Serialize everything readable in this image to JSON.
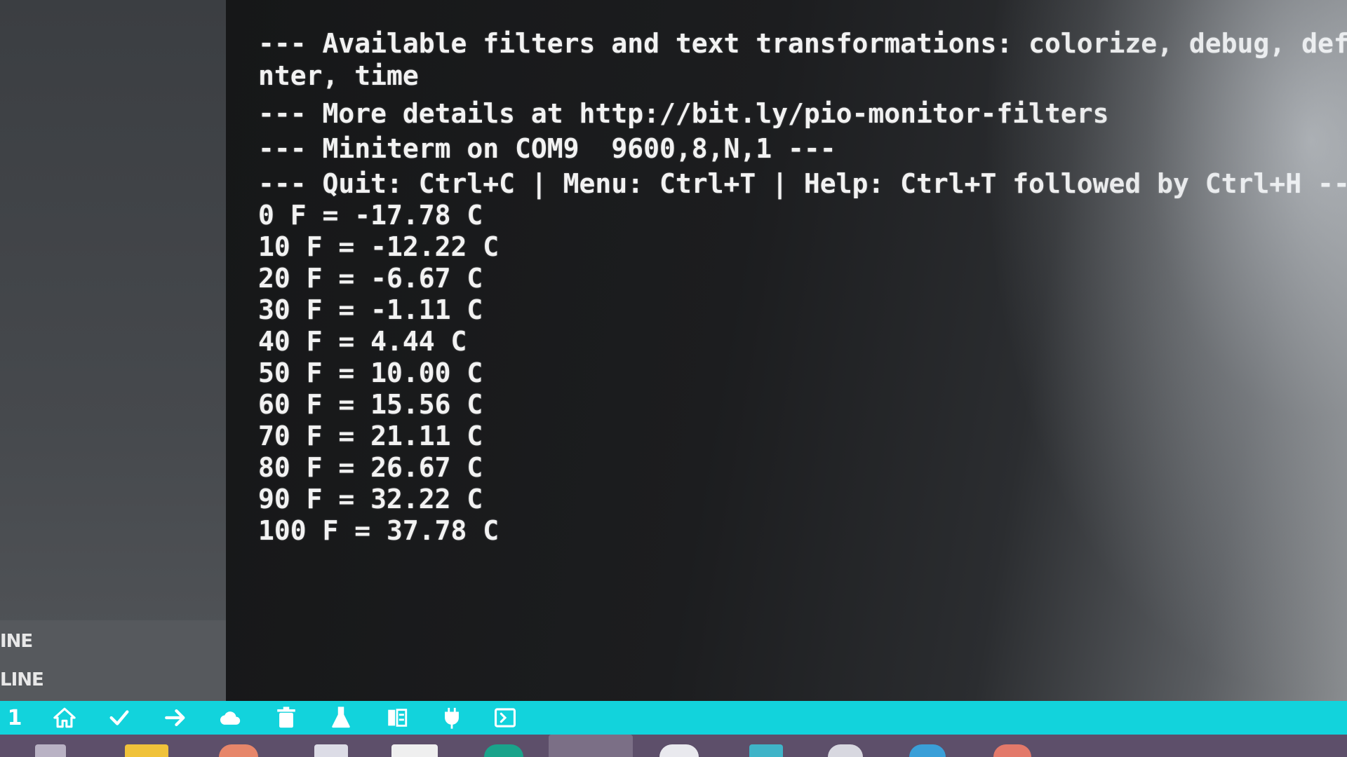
{
  "sidebar": {
    "outline_items": [
      "INE",
      "LINE"
    ]
  },
  "terminal": {
    "lines": [
      "--- Available filters and text transformations: colorize, debug, defa",
      "nter, time",
      "--- More details at http://bit.ly/pio-monitor-filters",
      "--- Miniterm on COM9  9600,8,N,1 ---",
      "--- Quit: Ctrl+C | Menu: Ctrl+T | Help: Ctrl+T followed by Ctrl+H ---",
      "0 F = -17.78 C",
      "10 F = -12.22 C",
      "20 F = -6.67 C",
      "30 F = -1.11 C",
      "40 F = 4.44 C",
      "50 F = 10.00 C",
      "60 F = 15.56 C",
      "70 F = 21.11 C",
      "80 F = 26.67 C",
      "90 F = 32.22 C",
      "100 F = 37.78 C"
    ]
  },
  "statusbar": {
    "counter": "1",
    "icons": [
      "home-icon",
      "check-icon",
      "arrow-right-icon",
      "cloud-icon",
      "trash-icon",
      "flask-icon",
      "serial-monitor-icon",
      "plug-icon",
      "terminal-icon"
    ],
    "background": "#12d3dc"
  },
  "colors": {
    "terminal_text": "#f2f2f2",
    "terminal_bg": "#1a1c1e",
    "taskbar": "#5d4f6a"
  }
}
